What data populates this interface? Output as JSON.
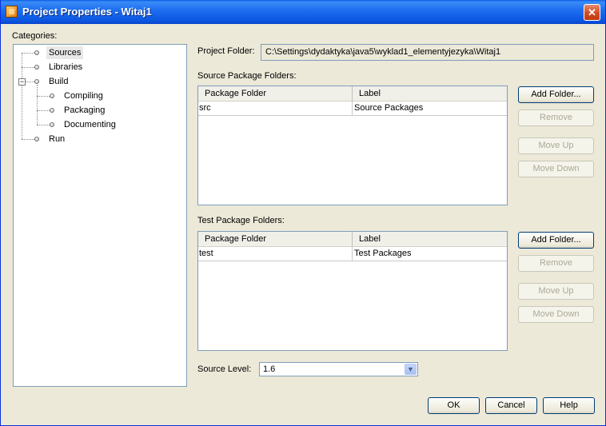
{
  "window": {
    "title": "Project Properties - Witaj1",
    "close_symbol": "✕"
  },
  "categories": {
    "label": "Categories:",
    "items": [
      {
        "label": "Sources",
        "selected": true
      },
      {
        "label": "Libraries"
      },
      {
        "label": "Build",
        "expanded": true
      },
      {
        "label": "Compiling"
      },
      {
        "label": "Packaging"
      },
      {
        "label": "Documenting"
      },
      {
        "label": "Run"
      }
    ]
  },
  "project_folder": {
    "label": "Project Folder:",
    "value": "C:\\Settings\\dydaktyka\\java5\\wyklad1_elementyjezyka\\Witaj1"
  },
  "source_package_folders": {
    "label": "Source Package Folders:",
    "columns": [
      "Package Folder",
      "Label"
    ],
    "rows": [
      {
        "folder": "src",
        "label": "Source Packages"
      }
    ]
  },
  "test_package_folders": {
    "label": "Test Package Folders:",
    "columns": [
      "Package Folder",
      "Label"
    ],
    "rows": [
      {
        "folder": "test",
        "label": "Test Packages"
      }
    ]
  },
  "buttons": {
    "add_folder": "Add Folder...",
    "remove": "Remove",
    "move_up": "Move Up",
    "move_down": "Move Down",
    "ok": "OK",
    "cancel": "Cancel",
    "help": "Help"
  },
  "source_level": {
    "label": "Source Level:",
    "value": "1.6"
  },
  "colors": {
    "title_bar": "#0b55e0",
    "dialog_bg": "#ece9d8",
    "close_button": "#d24b22"
  }
}
